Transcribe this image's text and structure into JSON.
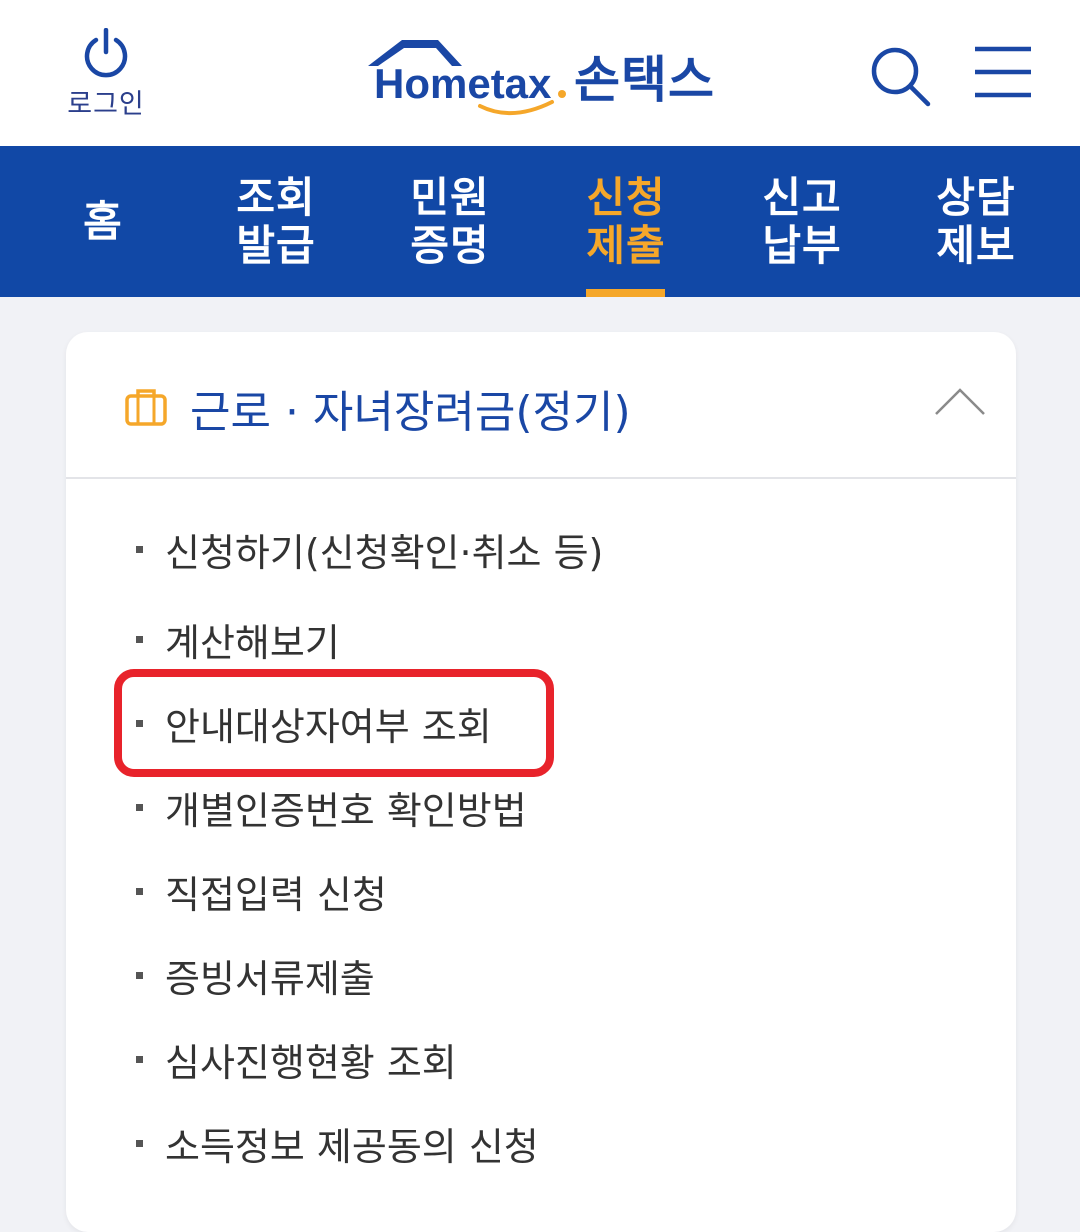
{
  "header": {
    "login_label": "로그인",
    "logo_text": "Hometax",
    "logo_korean": "손택스",
    "icons": {
      "login": "power-icon",
      "search": "search-icon",
      "menu": "hamburger-icon"
    }
  },
  "nav": {
    "items": [
      {
        "label": "홈",
        "active": false
      },
      {
        "label": "조회\n발급",
        "active": false
      },
      {
        "label": "민원\n증명",
        "active": false
      },
      {
        "label": "신청\n제출",
        "active": true
      },
      {
        "label": "신고\n납부",
        "active": false
      },
      {
        "label": "상담\n제보",
        "active": false
      }
    ]
  },
  "section": {
    "title": "근로 · 자녀장려금(정기)",
    "icon": "briefcase-icon",
    "collapse_icon": "chevron-up-icon",
    "items": [
      {
        "label": "신청하기(신청확인·취소 등)"
      },
      {
        "label": "계산해보기"
      },
      {
        "label": "안내대상자여부 조회",
        "highlighted": true
      },
      {
        "label": "개별인증번호 확인방법"
      },
      {
        "label": "직접입력 신청"
      },
      {
        "label": "증빙서류제출"
      },
      {
        "label": "심사진행현황 조회"
      },
      {
        "label": "소득정보 제공동의 신청"
      }
    ]
  },
  "colors": {
    "brand_blue": "#1148a6",
    "accent_orange": "#f5a72a",
    "highlight_red": "#e8232b"
  }
}
